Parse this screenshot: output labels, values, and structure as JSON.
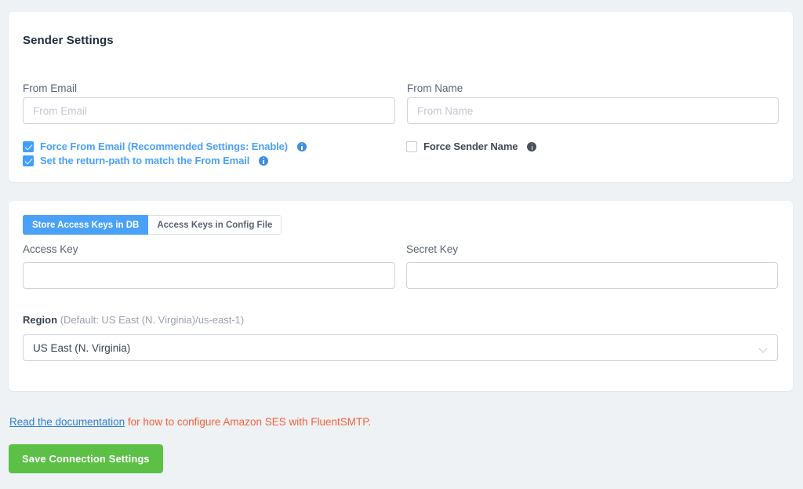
{
  "sender_card": {
    "title": "Sender Settings",
    "from_email": {
      "label": "From Email",
      "value": "",
      "placeholder": "From Email"
    },
    "from_name": {
      "label": "From Name",
      "value": "",
      "placeholder": "From Name"
    },
    "checkboxes": [
      {
        "label": "Force From Email (Recommended Settings: Enable)",
        "checked": true,
        "info_icon": "info-icon"
      },
      {
        "label": "Set the return-path to match the From Email",
        "checked": true,
        "info_icon": "info-icon"
      },
      {
        "label": "Force Sender Name",
        "checked": false,
        "info_icon": "info-icon"
      }
    ]
  },
  "keys_card": {
    "tabs": [
      {
        "label": "Store Access Keys in DB",
        "active": true
      },
      {
        "label": "Access Keys in Config File",
        "active": false
      }
    ],
    "access_key": {
      "label": "Access Key",
      "value": "",
      "placeholder": ""
    },
    "secret_key": {
      "label": "Secret Key",
      "value": "",
      "placeholder": ""
    },
    "region": {
      "label": "Region",
      "note": "(Default: US East (N. Virginia)/us-east-1)",
      "selected": "US East (N. Virginia)",
      "chevron_icon": "chevron-down-icon"
    }
  },
  "footer": {
    "doc_link_text": "Read the documentation",
    "doc_rest_text": " for how to configure Amazon SES with FluentSMTP.",
    "save_label": "Save Connection Settings"
  },
  "colors": {
    "page_bg": "#eef2f5",
    "accent_blue": "#4ba1f7",
    "link_blue": "#2f7fd4",
    "orange": "#f4623a",
    "green": "#5cc047"
  }
}
